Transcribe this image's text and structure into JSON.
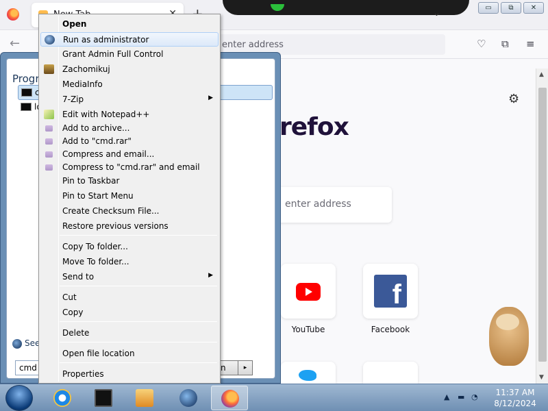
{
  "browser": {
    "tab_title": "New Tab",
    "tab_close": "✕",
    "new_tab": "+",
    "list_tabs": "⌄",
    "window_buttons": [
      "▭",
      "⧉",
      "✕"
    ],
    "back": "←",
    "url_placeholder": "enter address",
    "toolbar_icons": [
      "pocket-icon",
      "extensions-icon",
      "menu-icon"
    ],
    "toolbar_glyphs": [
      "♡",
      "⧉",
      "≡"
    ],
    "settings_glyph": "⚙",
    "logo_text": "refox",
    "search_placeholder": "enter address",
    "shortcuts": [
      {
        "label": "YouTube"
      },
      {
        "label": "Facebook"
      }
    ]
  },
  "start_menu": {
    "programs_title": "Progra",
    "items": [
      {
        "label": "c",
        "selected": true
      },
      {
        "label": "lo",
        "selected": false
      }
    ],
    "see_more": "See",
    "search_value": "cmd",
    "shutdown_label": "n",
    "shutdown_arrow": "▸"
  },
  "context_menu": {
    "items": [
      {
        "label": "Open",
        "bold": true,
        "icon": "",
        "submenu": false
      },
      {
        "label": "Run as administrator",
        "bold": false,
        "icon": "globe",
        "submenu": false,
        "hover": true
      },
      {
        "label": "Grant Admin Full Control",
        "bold": false,
        "icon": "",
        "submenu": false
      },
      {
        "label": "Zachomikuj",
        "bold": false,
        "icon": "user",
        "submenu": false
      },
      {
        "label": "MediaInfo",
        "bold": false,
        "icon": "",
        "submenu": false
      },
      {
        "label": "7-Zip",
        "bold": false,
        "icon": "",
        "submenu": true
      },
      {
        "label": "Edit with Notepad++",
        "bold": false,
        "icon": "notepad",
        "submenu": false
      },
      {
        "label": "Add to archive...",
        "bold": false,
        "icon": "rar",
        "submenu": false
      },
      {
        "label": "Add to \"cmd.rar\"",
        "bold": false,
        "icon": "rar",
        "submenu": false
      },
      {
        "label": "Compress and email...",
        "bold": false,
        "icon": "rar",
        "submenu": false
      },
      {
        "label": "Compress to \"cmd.rar\" and email",
        "bold": false,
        "icon": "rar",
        "submenu": false
      },
      {
        "label": "Pin to Taskbar",
        "bold": false,
        "icon": "",
        "submenu": false
      },
      {
        "label": "Pin to Start Menu",
        "bold": false,
        "icon": "",
        "submenu": false
      },
      {
        "label": "Create Checksum File...",
        "bold": false,
        "icon": "",
        "submenu": false
      },
      {
        "label": "Restore previous versions",
        "bold": false,
        "icon": "",
        "submenu": false
      },
      {
        "label": "Copy To folder...",
        "bold": false,
        "icon": "",
        "submenu": false
      },
      {
        "label": "Move To folder...",
        "bold": false,
        "icon": "",
        "submenu": false
      },
      {
        "label": "Send to",
        "bold": false,
        "icon": "",
        "submenu": true
      },
      {
        "label": "Cut",
        "bold": false,
        "icon": "",
        "submenu": false
      },
      {
        "label": "Copy",
        "bold": false,
        "icon": "",
        "submenu": false
      },
      {
        "label": "Delete",
        "bold": false,
        "icon": "",
        "submenu": false
      },
      {
        "label": "Open file location",
        "bold": false,
        "icon": "",
        "submenu": false
      },
      {
        "label": "Properties",
        "bold": false,
        "icon": "",
        "submenu": false
      }
    ],
    "submenu_arrow": "▶"
  },
  "taskbar": {
    "apps": [
      {
        "name": "internet-explorer-icon",
        "active": false
      },
      {
        "name": "command-prompt-icon",
        "active": false
      },
      {
        "name": "media-player-icon",
        "active": false
      },
      {
        "name": "globe-app-icon",
        "active": false
      },
      {
        "name": "firefox-icon",
        "active": true
      }
    ],
    "tray_glyphs": [
      "▲",
      "▬",
      "◔",
      "🔊"
    ],
    "time": "11:37 AM",
    "date": "8/12/2024"
  }
}
